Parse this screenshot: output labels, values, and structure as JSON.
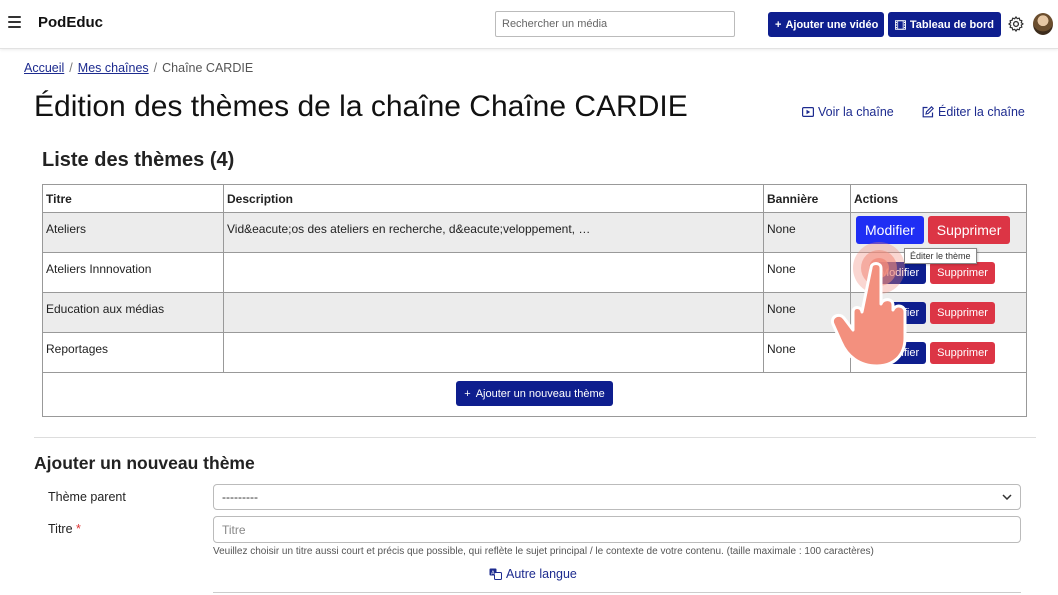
{
  "header": {
    "brand": "PodEduc",
    "search_placeholder": "Rechercher un média",
    "add_video_label": "Ajouter une vidéo",
    "dashboard_label": "Tableau de bord"
  },
  "breadcrumb": {
    "home": "Accueil",
    "channels": "Mes chaînes",
    "current": "Chaîne CARDIE"
  },
  "page": {
    "title": "Édition des thèmes de la chaîne Chaîne CARDIE",
    "view_channel": "Voir la chaîne",
    "edit_channel": "Éditer la chaîne"
  },
  "themes": {
    "list_title": "Liste des thèmes (4)",
    "columns": [
      "Titre",
      "Description",
      "Bannière",
      "Actions"
    ],
    "rows": [
      {
        "title": "Ateliers",
        "description": "Vid&eacute;os des ateliers en recherche, d&eacute;veloppement, …",
        "banner": "None"
      },
      {
        "title": "Ateliers Innnovation",
        "description": "",
        "banner": "None"
      },
      {
        "title": "Education aux médias",
        "description": "",
        "banner": "None"
      },
      {
        "title": "Reportages",
        "description": "",
        "banner": "None"
      }
    ],
    "modify_label": "Modifier",
    "modify_partial_label": "Modifier",
    "delete_label": "Supprimer",
    "tooltip": "Éditer le thème",
    "add_theme_label": "Ajouter un nouveau thème"
  },
  "form": {
    "section_title": "Ajouter un nouveau thème",
    "parent_label": "Thème parent",
    "parent_value": "---------",
    "title_label": "Titre",
    "required_mark": "*",
    "title_placeholder": "Titre",
    "help_text": "Veuillez choisir un titre aussi court et précis que possible, qui reflète le sujet principal / le contexte de votre contenu. (taille maximale : 100 caractères)",
    "other_language": "Autre langue"
  },
  "colors": {
    "navy": "#0e1e8e",
    "blue": "#1f2ef4",
    "danger": "#dc3545",
    "link": "#1d2b8f"
  }
}
